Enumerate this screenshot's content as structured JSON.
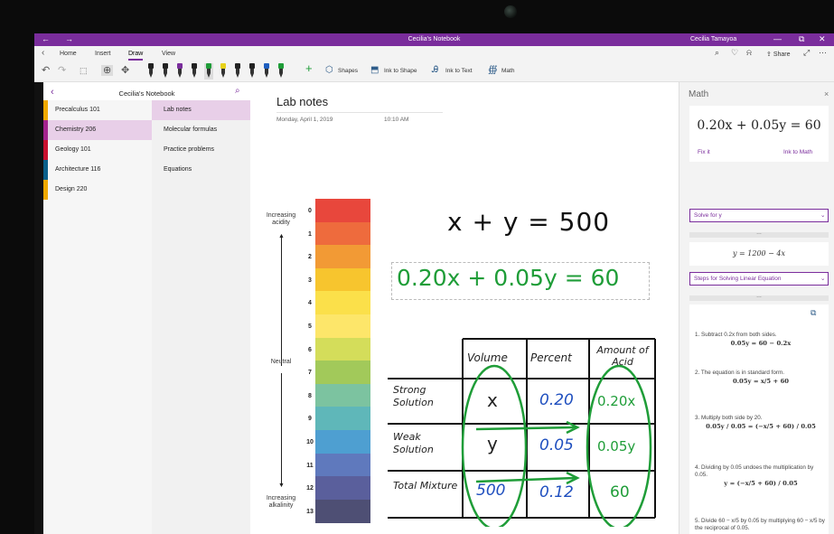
{
  "window": {
    "title": "Cecilia's Notebook",
    "user": "Cecilia Tamayoa",
    "minimize": "—",
    "restore": "⧉",
    "close": "✕"
  },
  "ribbon": {
    "tabs": [
      "Home",
      "Insert",
      "Draw",
      "View"
    ],
    "active_tab": "Draw",
    "share_label": "Share"
  },
  "toolbar": {
    "shapes_label": "Shapes",
    "ink_to_shape_label": "Ink to Shape",
    "ink_to_text_label": "Ink to Text",
    "math_label": "Math",
    "pen_colors": [
      "#222222",
      "#222222",
      "#7a2d9c",
      "#222222",
      "#1f9d38",
      "#e8d21a",
      "#222222",
      "#222222",
      "#1f5fbf",
      "#1f9d38"
    ]
  },
  "notebook": {
    "name": "Cecilia's Notebook",
    "sections": [
      {
        "label": "Precalculus 101",
        "color": "#f0a800"
      },
      {
        "label": "Chemistry 206",
        "color": "#a3238e"
      },
      {
        "label": "Geology 101",
        "color": "#c8102e"
      },
      {
        "label": "Architecture 116",
        "color": "#0b5f8a"
      },
      {
        "label": "Design 220",
        "color": "#f0a800"
      }
    ],
    "active_section": "Chemistry 206",
    "pages": [
      "Lab notes",
      "Molecular formulas",
      "Practice problems",
      "Equations"
    ],
    "active_page": "Lab notes"
  },
  "page": {
    "title": "Lab notes",
    "date": "Monday, April 1, 2019",
    "time": "10:10 AM"
  },
  "ph_scale": {
    "top_label": "Increasing acidity",
    "middle_label": "Neutral",
    "bottom_label": "Increasing alkalinity",
    "numbers": [
      "0",
      "1",
      "2",
      "3",
      "4",
      "5",
      "6",
      "7",
      "8",
      "9",
      "10",
      "11",
      "12",
      "13"
    ],
    "colors": [
      "#e8473c",
      "#ee6b3d",
      "#f29a35",
      "#f7c52e",
      "#fbe04a",
      "#fde66a",
      "#d4dd5a",
      "#a2c95a",
      "#7cc3a0",
      "#5fb7b9",
      "#4e9fd1",
      "#5f79bd",
      "#5a5f9c",
      "#4e4f74"
    ]
  },
  "handwriting": {
    "equation1": "x + y = 500",
    "equation2": "0.20x + 0.05y = 60",
    "table": {
      "headers": [
        "Volume",
        "Percent",
        "Amount of Acid"
      ],
      "row_labels": [
        "Strong Solution",
        "Weak Solution",
        "Total Mixture"
      ],
      "volume": [
        "x",
        "y",
        "500"
      ],
      "percent": [
        "0.20",
        "0.05",
        "0.12"
      ],
      "amount": [
        "0.20x",
        "0.05y",
        "60"
      ]
    }
  },
  "math_panel": {
    "title": "Math",
    "close": "×",
    "equation": "0.20x + 0.05y = 60",
    "fix_it": "Fix it",
    "ink_to_math": "Ink to Math",
    "action": "Solve for y",
    "result": "y = 1200 − 4x",
    "steps_dropdown": "Steps for Solving Linear Equation",
    "steps": [
      {
        "text": "1.   Subtract 0.2x from both sides.",
        "eq": "0.05y = 60 − 0.2x"
      },
      {
        "text": "2.   The equation is in standard form.",
        "eq": "0.05y = x/5 + 60"
      },
      {
        "text": "3.   Multiply both side by 20.",
        "eq": "0.05y / 0.05 = (−x/5 + 60) / 0.05"
      },
      {
        "text": "4.   Dividing by 0.05 undoes the multiplication by 0.05.",
        "eq": "y = (−x/5 + 60) / 0.05"
      },
      {
        "text": "5.   Divide 60 − x/5 by 0.05 by multiplying 60 − x/5 by the reciprocal of 0.05.",
        "eq": ""
      }
    ]
  }
}
